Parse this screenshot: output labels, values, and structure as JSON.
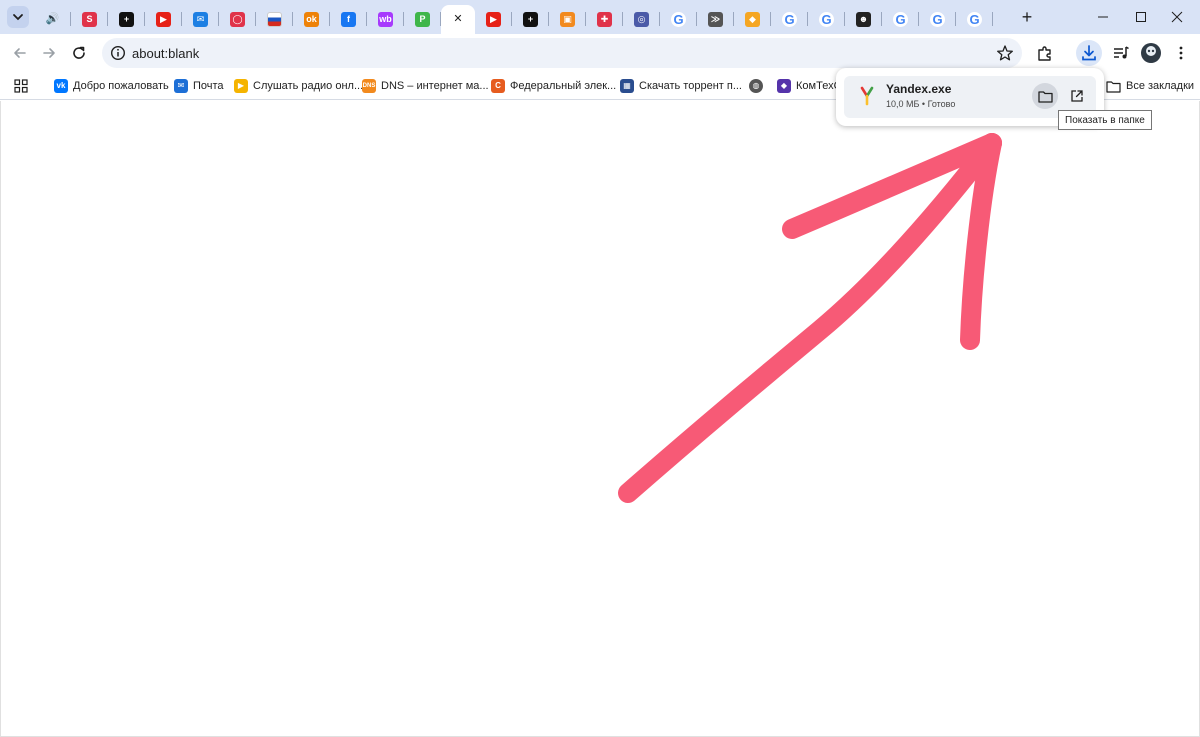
{
  "browser": {
    "tab_icons": [
      {
        "name": "speaker-icon",
        "glyph": "🔊",
        "bg": "",
        "color": "#333"
      },
      {
        "name": "s-tile-icon",
        "glyph": "S",
        "bg": "#e0334a",
        "color": "#fff"
      },
      {
        "name": "plus-tile-icon",
        "glyph": "+",
        "bg": "#111111",
        "color": "#fff"
      },
      {
        "name": "youtube-icon",
        "glyph": "▶",
        "bg": "#e62117",
        "color": "#fff"
      },
      {
        "name": "mail-icon",
        "glyph": "✉",
        "bg": "#1d7fe3",
        "color": "#fff"
      },
      {
        "name": "ring-icon",
        "glyph": "◯",
        "bg": "#e0334a",
        "color": "#fff"
      },
      {
        "name": "russia-flag-icon",
        "glyph": "",
        "bg": "flag",
        "color": "#fff"
      },
      {
        "name": "odnoklassniki-icon",
        "glyph": "ok",
        "bg": "#ee8208",
        "color": "#fff"
      },
      {
        "name": "facebook-icon",
        "glyph": "f",
        "bg": "#1877f2",
        "color": "#fff"
      },
      {
        "name": "wildberries-icon",
        "glyph": "wb",
        "bg": "#a73afd",
        "color": "#fff"
      },
      {
        "name": "green-p-icon",
        "glyph": "P",
        "bg": "#3fb64a",
        "color": "#fff"
      },
      {
        "name": "close-icon",
        "glyph": "✕",
        "bg": "",
        "color": "#1f1f1f",
        "active": true
      },
      {
        "name": "youtube-icon",
        "glyph": "▶",
        "bg": "#e62117",
        "color": "#fff"
      },
      {
        "name": "plus-tile-icon",
        "glyph": "+",
        "bg": "#111111",
        "color": "#fff"
      },
      {
        "name": "box-icon",
        "glyph": "▣",
        "bg": "#f28a1e",
        "color": "#fff"
      },
      {
        "name": "lifebuoy-icon",
        "glyph": "✚",
        "bg": "#e0334a",
        "color": "#fff"
      },
      {
        "name": "globe-badge-icon",
        "glyph": "◎",
        "bg": "#4a5aa8",
        "color": "#fff"
      },
      {
        "name": "google-icon",
        "glyph": "G",
        "bg": "g",
        "color": "#4285f4"
      },
      {
        "name": "fish-icon",
        "glyph": "≫",
        "bg": "#555555",
        "color": "#fff"
      },
      {
        "name": "orange-badge-icon",
        "glyph": "◆",
        "bg": "#f5a623",
        "color": "#fff"
      },
      {
        "name": "google-icon",
        "glyph": "G",
        "bg": "g",
        "color": "#4285f4"
      },
      {
        "name": "google-icon",
        "glyph": "G",
        "bg": "g",
        "color": "#4285f4"
      },
      {
        "name": "face-icon",
        "glyph": "☻",
        "bg": "#222222",
        "color": "#fff"
      },
      {
        "name": "google-icon",
        "glyph": "G",
        "bg": "g",
        "color": "#4285f4"
      },
      {
        "name": "google-icon",
        "glyph": "G",
        "bg": "g",
        "color": "#4285f4"
      },
      {
        "name": "google-icon",
        "glyph": "G",
        "bg": "g",
        "color": "#4285f4"
      }
    ],
    "new_tab_label": "+"
  },
  "toolbar": {
    "url": "about:blank"
  },
  "bookmarks": {
    "items": [
      {
        "label": "Добро пожаловать",
        "icon": "vk-icon",
        "glyph": "vk",
        "bg": "#0077ff"
      },
      {
        "label": "Почта",
        "icon": "mail-icon",
        "glyph": "✉",
        "bg": "#1d6fd6"
      },
      {
        "label": "Слушать радио онл...",
        "icon": "play-icon",
        "glyph": "▶",
        "bg": "#f5b400"
      },
      {
        "label": "DNS – интернет ма...",
        "icon": "dns-icon",
        "glyph": "DNS",
        "bg": "#f28a1e"
      },
      {
        "label": "Федеральный элек...",
        "icon": "orange-c-icon",
        "glyph": "C",
        "bg": "#e65c1f"
      },
      {
        "label": "Скачать торрент п...",
        "icon": "grid-tile-icon",
        "glyph": "▦",
        "bg": "#2a4d8f"
      },
      {
        "label": "",
        "icon": "globe-icon",
        "glyph": "◍",
        "bg": "#555555"
      },
      {
        "label": "КомТехС",
        "icon": "komtech-icon",
        "glyph": "◆",
        "bg": "#5533aa"
      }
    ],
    "all_bookmarks_label": "Все закладки"
  },
  "download": {
    "filename": "Yandex.exe",
    "status": "10,0 МБ • Готово",
    "tooltip": "Показать в папке"
  },
  "annotation": {
    "arrow_color": "#f75a76"
  }
}
